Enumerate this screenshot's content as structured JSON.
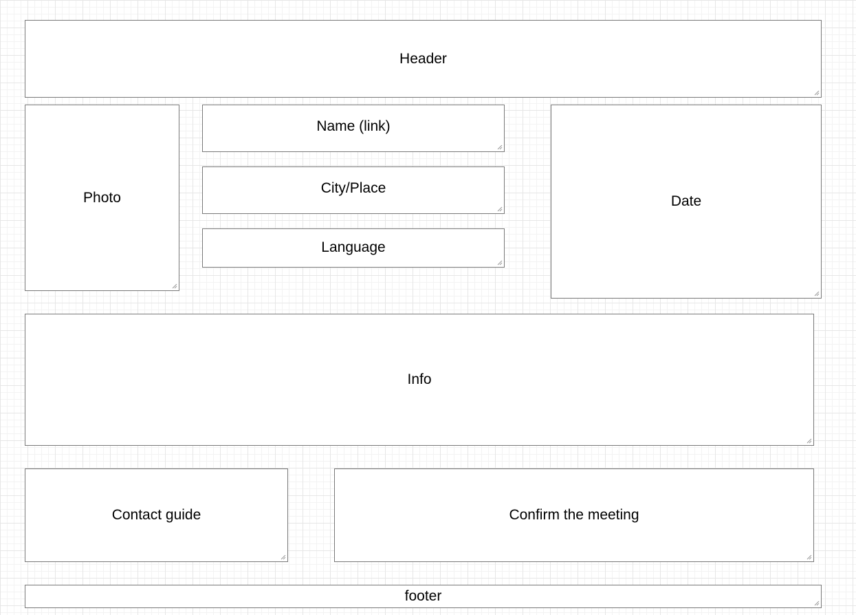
{
  "boxes": {
    "header": "Header",
    "photo": "Photo",
    "name": "Name (link)",
    "city": "City/Place",
    "language": "Language",
    "date": "Date",
    "info": "Info",
    "contact": "Contact guide",
    "confirm": "Confirm the meeting",
    "footer": "footer"
  },
  "colors": {
    "border": "#777777",
    "grid": "#e6e6e6",
    "box_fill": "#ffffff"
  },
  "icons": {
    "resize_handle": "resize-grip-icon"
  }
}
